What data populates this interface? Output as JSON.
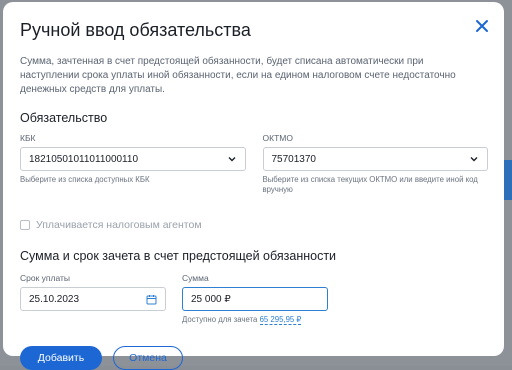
{
  "dialog": {
    "title": "Ручной ввод обязательства",
    "description": "Сумма, зачтенная в счет предстоящей обязанности, будет списана автоматически при наступлении срока уплаты иной обязанности, если на едином налоговом счете недостаточно денежных средств для уплаты.",
    "close_icon": "close-icon"
  },
  "obligation": {
    "section_title": "Обязательство",
    "kbk": {
      "label": "КБК",
      "value": "18210501011011000110",
      "hint": "Выберите из списка доступных КБК",
      "icon": "chevron-down-icon"
    },
    "oktmo": {
      "label": "ОКТМО",
      "value": "75701370",
      "hint": "Выберите из списка текущих ОКТМО или введите иной код вручную",
      "icon": "chevron-down-icon"
    },
    "agent_checkbox": {
      "label": "Уплачивается налоговым агентом",
      "checked": false
    }
  },
  "offset": {
    "section_title": "Сумма и срок зачета в счет предстоящей обязанности",
    "date": {
      "label": "Срок уплаты",
      "value": "25.10.2023",
      "icon": "calendar-icon"
    },
    "amount": {
      "label": "Сумма",
      "value": "25 000 ₽",
      "available_text": "Доступно для зачета",
      "available_value": "65 295,95 ₽"
    }
  },
  "actions": {
    "submit_label": "Добавить",
    "cancel_label": "Отмена"
  },
  "colors": {
    "accent": "#1c67d4",
    "active_border": "#2d7fd3",
    "overlay": "#8d9298"
  }
}
